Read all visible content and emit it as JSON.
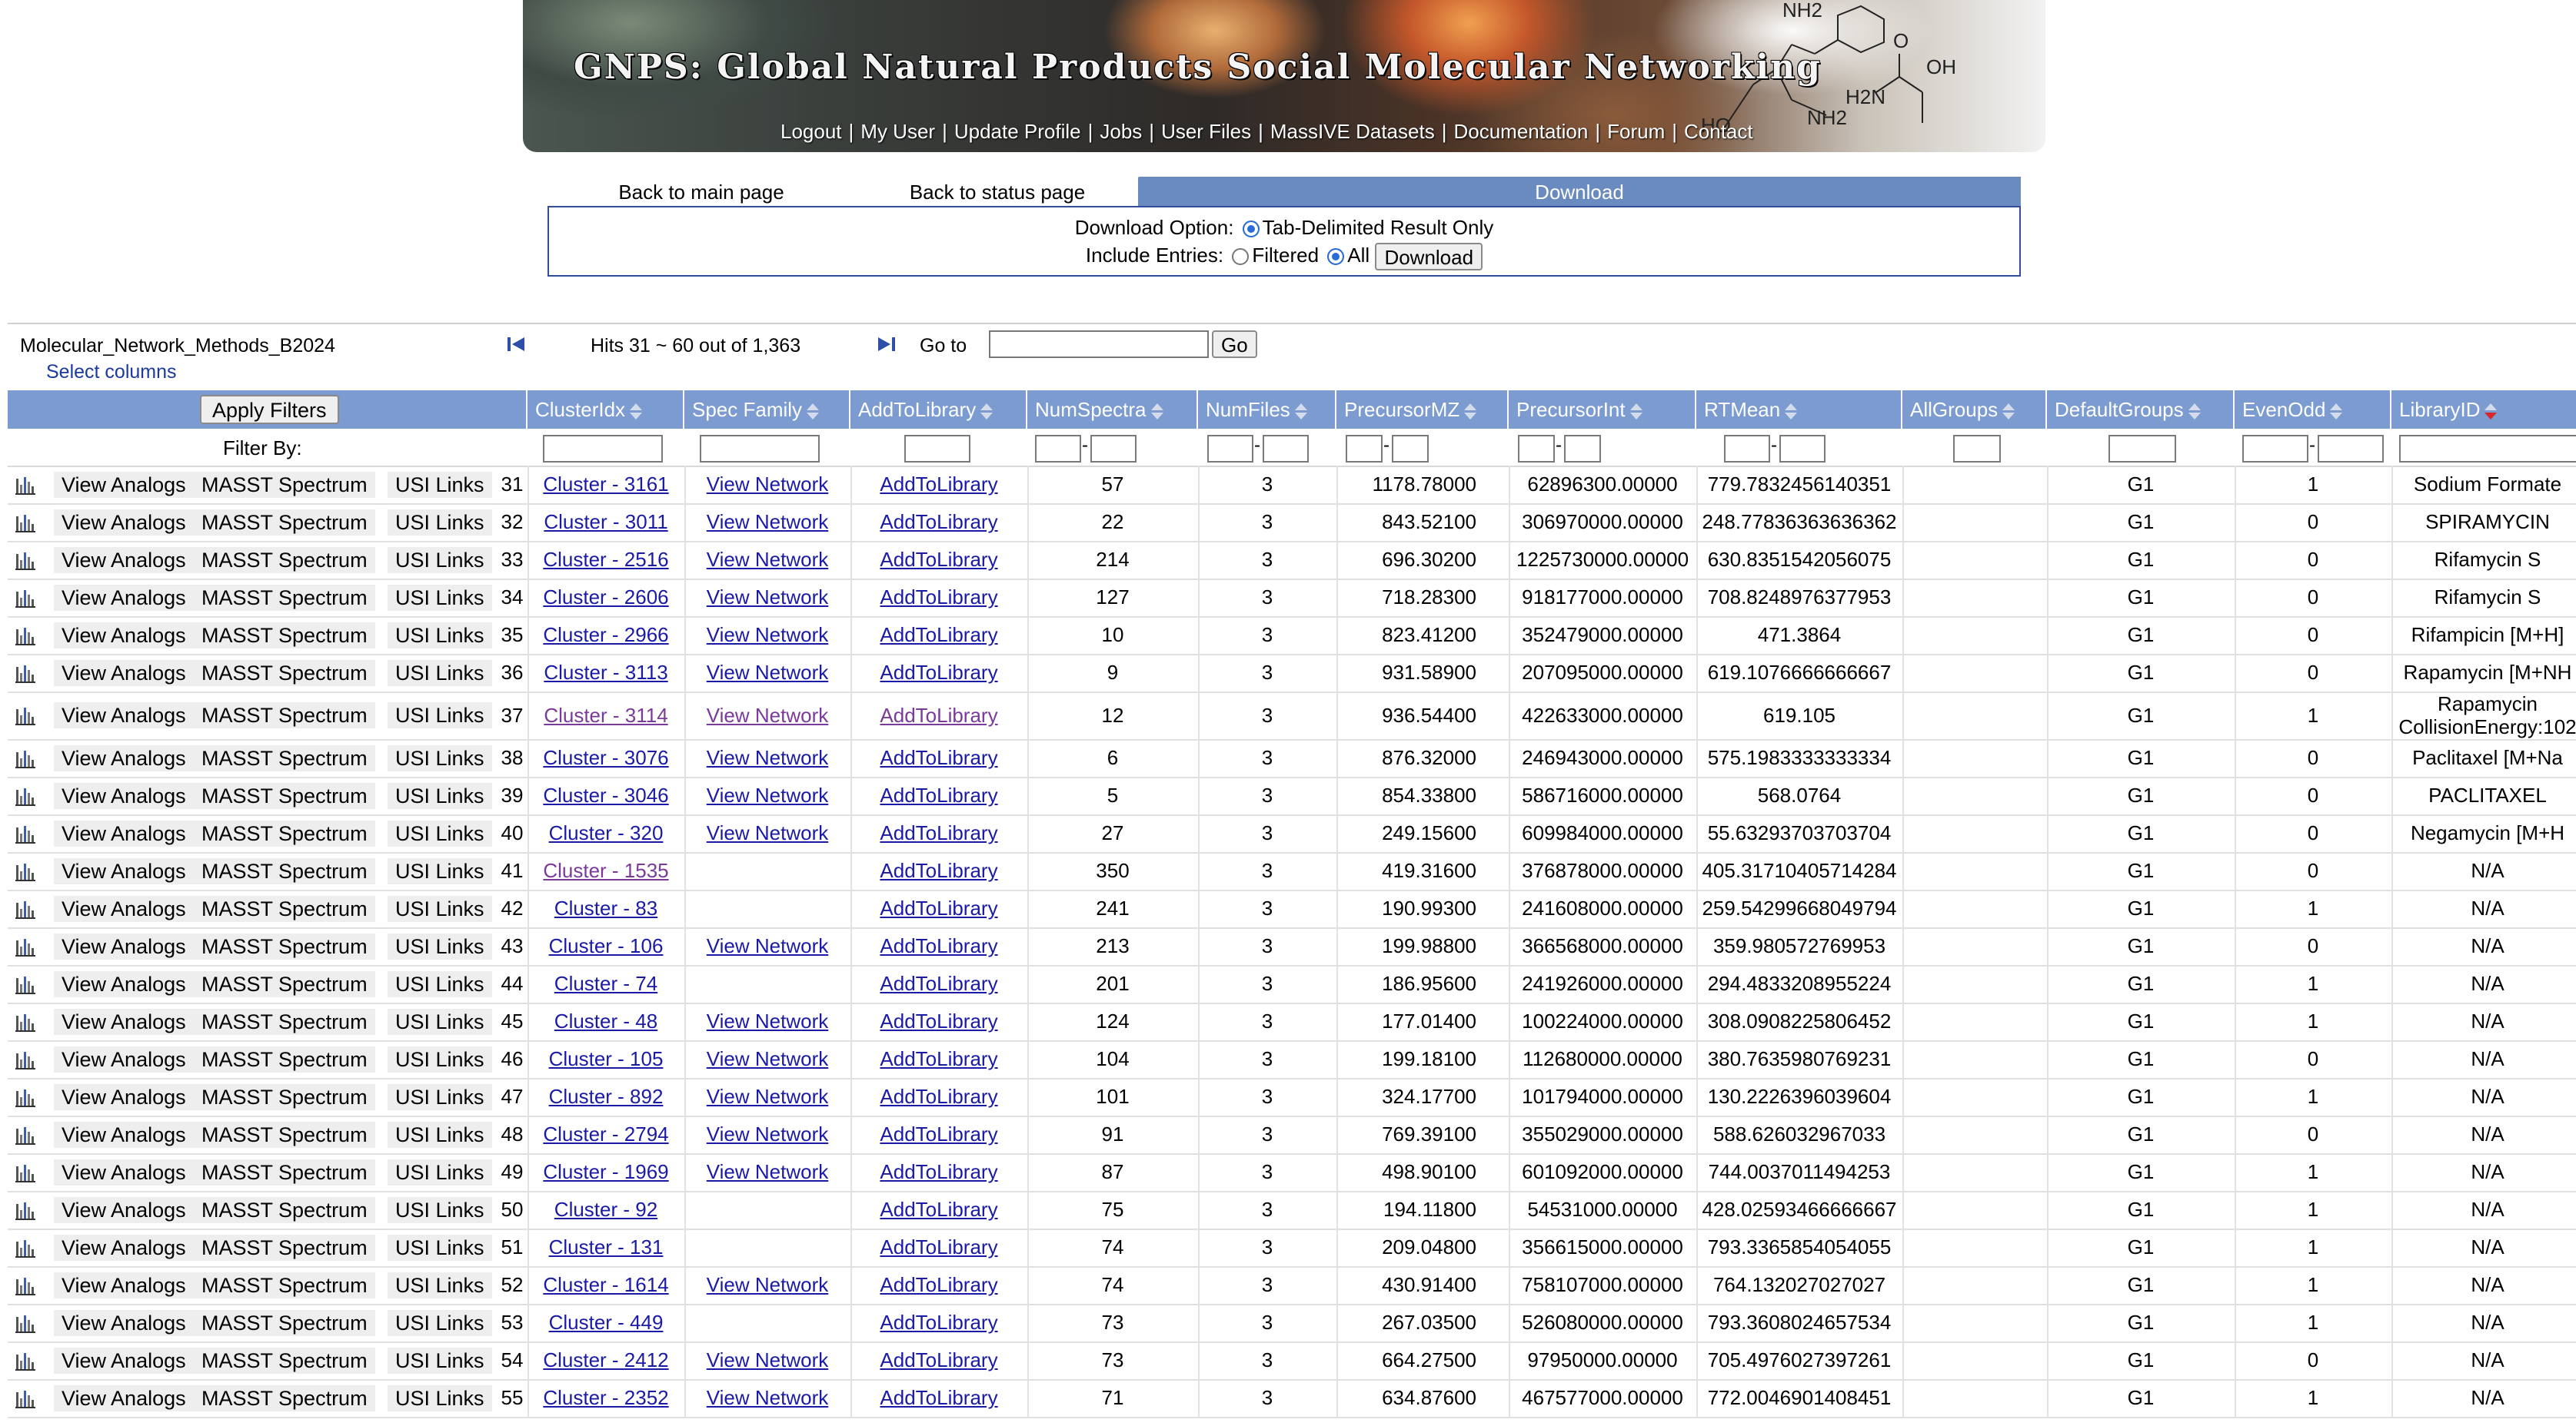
{
  "banner": {
    "title": "GNPS: Global Natural Products Social Molecular Networking",
    "nav": [
      "Logout",
      "My User",
      "Update Profile",
      "Jobs",
      "User Files",
      "MassIVE Datasets",
      "Documentation",
      "Forum",
      "Contact"
    ],
    "molecule_labels": [
      "NH2",
      "O",
      "OH",
      "H2N",
      "NH2",
      "HO"
    ]
  },
  "download": {
    "tab_main": "Back to main page",
    "tab_status": "Back to status page",
    "tab_download": "Download",
    "option_label": "Download Option:",
    "option_value": "Tab-Delimited Result Only",
    "include_label": "Include Entries:",
    "filtered_label": "Filtered",
    "all_label": "All",
    "button": "Download"
  },
  "paging": {
    "task_name": "Molecular_Network_Methods_B2024",
    "select_columns": "Select columns",
    "hits": "Hits 31 ~ 60 out of 1,363",
    "goto_label": "Go to",
    "go_button": "Go"
  },
  "table": {
    "apply_filters": "Apply Filters",
    "filter_by": "Filter By:",
    "columns": [
      "ClusterIdx",
      "Spec Family",
      "AddToLibrary",
      "NumSpectra",
      "NumFiles",
      "PrecursorMZ",
      "PrecursorInt",
      "RTMean",
      "AllGroups",
      "DefaultGroups",
      "EvenOdd",
      "LibraryID"
    ],
    "action_labels": {
      "view_analogs": "View Analogs",
      "masst": "MASST Spectrum",
      "usi": "USI Links"
    },
    "rows": [
      {
        "n": "31",
        "cluster": "Cluster - 3161",
        "family": "View Network",
        "add": "AddToLibrary",
        "spectra": "57",
        "files": "3",
        "mz": "1178.78000",
        "int": "62896300.00000",
        "rt": "779.7832456140351",
        "default": "G1",
        "evenodd": "1",
        "lib": "Sodium Formate"
      },
      {
        "n": "32",
        "cluster": "Cluster - 3011",
        "family": "View Network",
        "add": "AddToLibrary",
        "spectra": "22",
        "files": "3",
        "mz": "843.52100",
        "int": "306970000.00000",
        "rt": "248.77836363636362",
        "default": "G1",
        "evenodd": "0",
        "lib": "SPIRAMYCIN"
      },
      {
        "n": "33",
        "cluster": "Cluster - 2516",
        "family": "View Network",
        "add": "AddToLibrary",
        "spectra": "214",
        "files": "3",
        "mz": "696.30200",
        "int": "1225730000.00000",
        "rt": "630.8351542056075",
        "default": "G1",
        "evenodd": "0",
        "lib": "Rifamycin S"
      },
      {
        "n": "34",
        "cluster": "Cluster - 2606",
        "family": "View Network",
        "add": "AddToLibrary",
        "spectra": "127",
        "files": "3",
        "mz": "718.28300",
        "int": "918177000.00000",
        "rt": "708.8248976377953",
        "default": "G1",
        "evenodd": "0",
        "lib": "Rifamycin S"
      },
      {
        "n": "35",
        "cluster": "Cluster - 2966",
        "family": "View Network",
        "add": "AddToLibrary",
        "spectra": "10",
        "files": "3",
        "mz": "823.41200",
        "int": "352479000.00000",
        "rt": "471.3864",
        "default": "G1",
        "evenodd": "0",
        "lib": "Rifampicin [M+H]"
      },
      {
        "n": "36",
        "cluster": "Cluster - 3113",
        "family": "View Network",
        "add": "AddToLibrary",
        "spectra": "9",
        "files": "3",
        "mz": "931.58900",
        "int": "207095000.00000",
        "rt": "619.1076666666667",
        "default": "G1",
        "evenodd": "0",
        "lib": "Rapamycin [M+NH"
      },
      {
        "n": "37",
        "cluster": "Cluster - 3114",
        "family": "View Network",
        "add": "AddToLibrary",
        "spectra": "12",
        "files": "3",
        "mz": "936.54400",
        "int": "422633000.00000",
        "rt": "619.105",
        "default": "G1",
        "evenodd": "1",
        "lib": "Rapamycin CollisionEnergy:102",
        "visited": true
      },
      {
        "n": "38",
        "cluster": "Cluster - 3076",
        "family": "View Network",
        "add": "AddToLibrary",
        "spectra": "6",
        "files": "3",
        "mz": "876.32000",
        "int": "246943000.00000",
        "rt": "575.1983333333334",
        "default": "G1",
        "evenodd": "0",
        "lib": "Paclitaxel [M+Na"
      },
      {
        "n": "39",
        "cluster": "Cluster - 3046",
        "family": "View Network",
        "add": "AddToLibrary",
        "spectra": "5",
        "files": "3",
        "mz": "854.33800",
        "int": "586716000.00000",
        "rt": "568.0764",
        "default": "G1",
        "evenodd": "0",
        "lib": "PACLITAXEL"
      },
      {
        "n": "40",
        "cluster": "Cluster - 320",
        "family": "View Network",
        "add": "AddToLibrary",
        "spectra": "27",
        "files": "3",
        "mz": "249.15600",
        "int": "609984000.00000",
        "rt": "55.63293703703704",
        "default": "G1",
        "evenodd": "0",
        "lib": "Negamycin [M+H"
      },
      {
        "n": "41",
        "cluster": "Cluster - 1535",
        "family": "",
        "add": "AddToLibrary",
        "spectra": "350",
        "files": "3",
        "mz": "419.31600",
        "int": "376878000.00000",
        "rt": "405.31710405714284",
        "default": "G1",
        "evenodd": "0",
        "lib": "N/A",
        "visitedCluster": true
      },
      {
        "n": "42",
        "cluster": "Cluster - 83",
        "family": "",
        "add": "AddToLibrary",
        "spectra": "241",
        "files": "3",
        "mz": "190.99300",
        "int": "241608000.00000",
        "rt": "259.54299668049794",
        "default": "G1",
        "evenodd": "1",
        "lib": "N/A"
      },
      {
        "n": "43",
        "cluster": "Cluster - 106",
        "family": "View Network",
        "add": "AddToLibrary",
        "spectra": "213",
        "files": "3",
        "mz": "199.98800",
        "int": "366568000.00000",
        "rt": "359.980572769953",
        "default": "G1",
        "evenodd": "0",
        "lib": "N/A"
      },
      {
        "n": "44",
        "cluster": "Cluster - 74",
        "family": "",
        "add": "AddToLibrary",
        "spectra": "201",
        "files": "3",
        "mz": "186.95600",
        "int": "241926000.00000",
        "rt": "294.4833208955224",
        "default": "G1",
        "evenodd": "1",
        "lib": "N/A"
      },
      {
        "n": "45",
        "cluster": "Cluster - 48",
        "family": "View Network",
        "add": "AddToLibrary",
        "spectra": "124",
        "files": "3",
        "mz": "177.01400",
        "int": "100224000.00000",
        "rt": "308.0908225806452",
        "default": "G1",
        "evenodd": "1",
        "lib": "N/A"
      },
      {
        "n": "46",
        "cluster": "Cluster - 105",
        "family": "View Network",
        "add": "AddToLibrary",
        "spectra": "104",
        "files": "3",
        "mz": "199.18100",
        "int": "112680000.00000",
        "rt": "380.7635980769231",
        "default": "G1",
        "evenodd": "0",
        "lib": "N/A"
      },
      {
        "n": "47",
        "cluster": "Cluster - 892",
        "family": "View Network",
        "add": "AddToLibrary",
        "spectra": "101",
        "files": "3",
        "mz": "324.17700",
        "int": "101794000.00000",
        "rt": "130.2226396039604",
        "default": "G1",
        "evenodd": "1",
        "lib": "N/A"
      },
      {
        "n": "48",
        "cluster": "Cluster - 2794",
        "family": "View Network",
        "add": "AddToLibrary",
        "spectra": "91",
        "files": "3",
        "mz": "769.39100",
        "int": "355029000.00000",
        "rt": "588.626032967033",
        "default": "G1",
        "evenodd": "0",
        "lib": "N/A"
      },
      {
        "n": "49",
        "cluster": "Cluster - 1969",
        "family": "View Network",
        "add": "AddToLibrary",
        "spectra": "87",
        "files": "3",
        "mz": "498.90100",
        "int": "601092000.00000",
        "rt": "744.0037011494253",
        "default": "G1",
        "evenodd": "1",
        "lib": "N/A"
      },
      {
        "n": "50",
        "cluster": "Cluster - 92",
        "family": "",
        "add": "AddToLibrary",
        "spectra": "75",
        "files": "3",
        "mz": "194.11800",
        "int": "54531000.00000",
        "rt": "428.02593466666667",
        "default": "G1",
        "evenodd": "1",
        "lib": "N/A"
      },
      {
        "n": "51",
        "cluster": "Cluster - 131",
        "family": "",
        "add": "AddToLibrary",
        "spectra": "74",
        "files": "3",
        "mz": "209.04800",
        "int": "356615000.00000",
        "rt": "793.3365854054055",
        "default": "G1",
        "evenodd": "1",
        "lib": "N/A"
      },
      {
        "n": "52",
        "cluster": "Cluster - 1614",
        "family": "View Network",
        "add": "AddToLibrary",
        "spectra": "74",
        "files": "3",
        "mz": "430.91400",
        "int": "758107000.00000",
        "rt": "764.132027027027",
        "default": "G1",
        "evenodd": "1",
        "lib": "N/A"
      },
      {
        "n": "53",
        "cluster": "Cluster - 449",
        "family": "",
        "add": "AddToLibrary",
        "spectra": "73",
        "files": "3",
        "mz": "267.03500",
        "int": "526080000.00000",
        "rt": "793.3608024657534",
        "default": "G1",
        "evenodd": "1",
        "lib": "N/A"
      },
      {
        "n": "54",
        "cluster": "Cluster - 2412",
        "family": "View Network",
        "add": "AddToLibrary",
        "spectra": "73",
        "files": "3",
        "mz": "664.27500",
        "int": "97950000.00000",
        "rt": "705.4976027397261",
        "default": "G1",
        "evenodd": "0",
        "lib": "N/A"
      },
      {
        "n": "55",
        "cluster": "Cluster - 2352",
        "family": "View Network",
        "add": "AddToLibrary",
        "spectra": "71",
        "files": "3",
        "mz": "634.87600",
        "int": "467577000.00000",
        "rt": "772.0046901408451",
        "default": "G1",
        "evenodd": "1",
        "lib": "N/A"
      }
    ]
  },
  "colors": {
    "header_bg": "#7b9bd1",
    "tab_active": "#6a8bbf",
    "link": "#1a1aa6",
    "visited_link": "#7a3a9a",
    "sort_active": "#d8262a"
  }
}
